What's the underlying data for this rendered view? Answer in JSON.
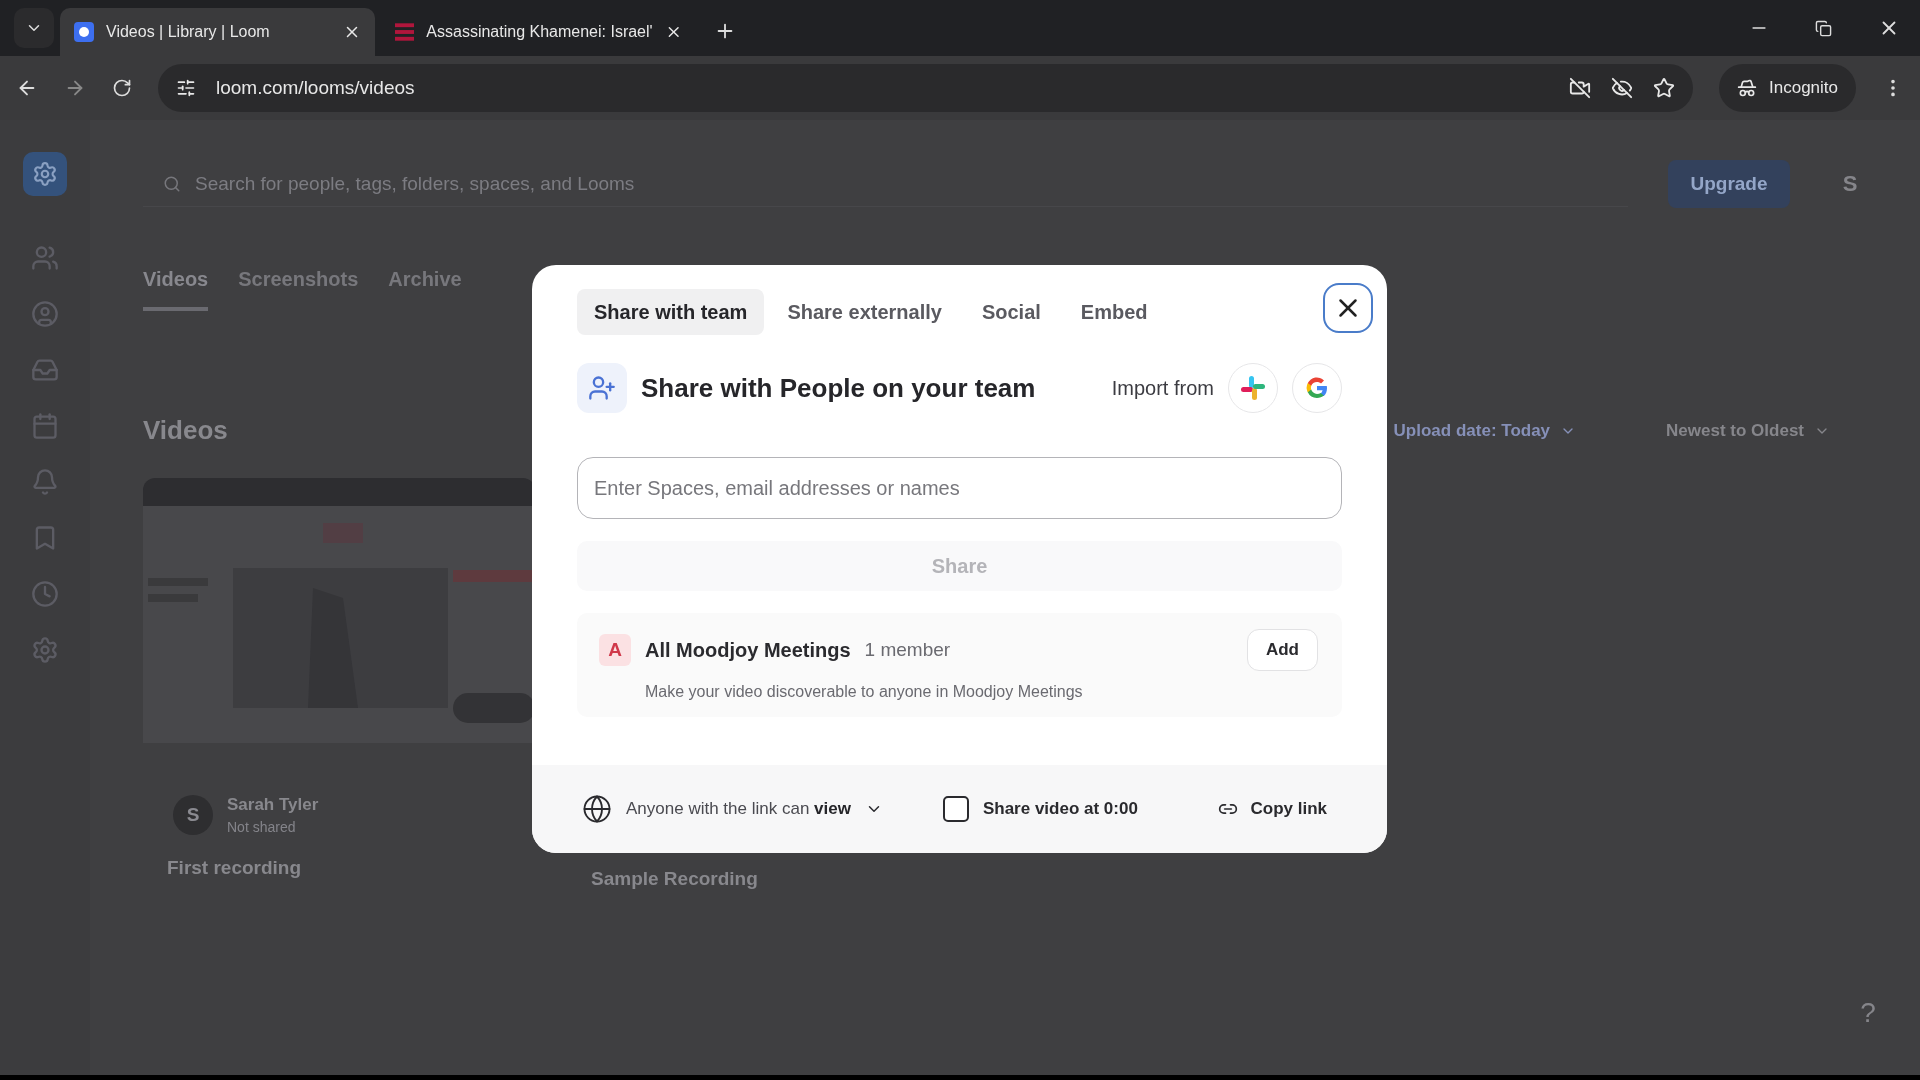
{
  "browser": {
    "tabs": [
      {
        "title": "Videos | Library | Loom",
        "selected": true,
        "kind": "loom"
      },
      {
        "title": "Assassinating Khamenei: Israel'",
        "selected": false,
        "kind": "news"
      }
    ],
    "url": "loom.com/looms/videos",
    "incognito": "Incognito"
  },
  "page": {
    "search": {
      "placeholder": "Search for people, tags, folders, spaces, and Looms"
    },
    "upgrade": "Upgrade",
    "avatar": "S",
    "tabs": [
      {
        "label": "Videos",
        "selected": true
      },
      {
        "label": "Screenshots",
        "selected": false
      },
      {
        "label": "Archive",
        "selected": false
      }
    ],
    "heading": "Videos",
    "filters": [
      "Upload date: Today",
      "Newest to Oldest"
    ],
    "cards": [
      {
        "owner_initial": "S",
        "owner": "Sarah Tyler",
        "status": "Not shared",
        "title": "First recording"
      },
      {
        "title": "Sample Recording"
      }
    ],
    "help": "?"
  },
  "modal": {
    "tabs": [
      {
        "label": "Share with team",
        "selected": true
      },
      {
        "label": "Share externally",
        "selected": false
      },
      {
        "label": "Social",
        "selected": false
      },
      {
        "label": "Embed",
        "selected": false
      }
    ],
    "heading": "Share with People on your team",
    "import_label": "Import from",
    "input": {
      "placeholder": "Enter Spaces, email addresses or names"
    },
    "share_button": "Share",
    "team": {
      "initial": "A",
      "name": "All Moodjoy Meetings",
      "members": "1 member",
      "description": "Make your video discoverable to anyone in Moodjoy Meetings",
      "add": "Add"
    },
    "footer": {
      "access": "Anyone with the link can **view**",
      "share_at": {
        "label": "Share video at 0:00",
        "checked": false
      },
      "copy_link": "Copy link"
    }
  }
}
